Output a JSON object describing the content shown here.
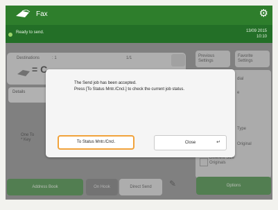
{
  "app": {
    "title": "Fax"
  },
  "status": {
    "message": "Ready to send.",
    "date": "13/09 2015",
    "time": "10:10"
  },
  "destinations": {
    "label": "Destinations",
    "count": ": 1",
    "page": "1/1"
  },
  "details_label": "Details",
  "one_touch_label_1": "One To",
  "one_touch_label_2": "* Key",
  "side": {
    "previous_settings": [
      "Previous",
      "Settings"
    ],
    "favorite_settings": [
      "Favorite",
      "Settings"
    ],
    "item_partial_1": "dial",
    "item_partial_2": "e",
    "item_type": "Type",
    "item_original": "Original",
    "different_size": [
      "Different Size",
      "Originals"
    ]
  },
  "bottom": {
    "address_book": "Address Book",
    "on_hook": "On Hook",
    "direct_send": "Direct Send",
    "options": "Options"
  },
  "dialog": {
    "line1": "The Send job has been accepted.",
    "line2": "Press [To Status Mntr./Cncl.] to check the current job status.",
    "status_button": "To Status Mntr./Cncl.",
    "close_button": "Close"
  },
  "colors": {
    "header_green": "#2e7e2c",
    "status_green": "#236f27",
    "highlight": "#f1a23a"
  }
}
